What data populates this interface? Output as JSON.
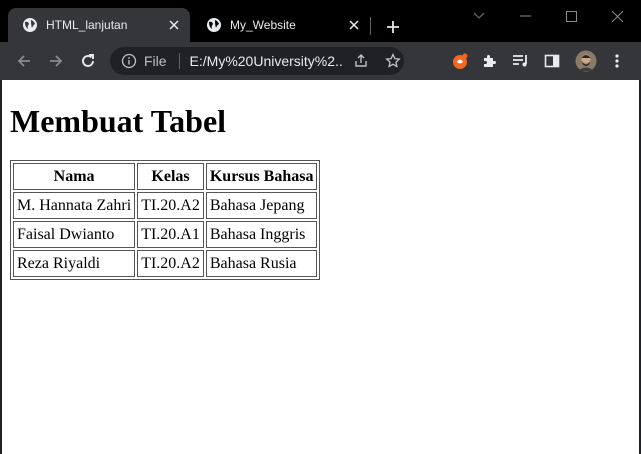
{
  "tabs": [
    {
      "title": "HTML_lanjutan",
      "active": true,
      "favicon": "globe-icon"
    },
    {
      "title": "My_Website",
      "active": false,
      "favicon": "globe-icon"
    }
  ],
  "toolbar": {
    "scheme": "File",
    "url": "E:/My%20University%2..."
  },
  "page": {
    "heading": "Membuat Tabel",
    "table": {
      "headers": [
        "Nama",
        "Kelas",
        "Kursus Bahasa"
      ],
      "rows": [
        [
          "M. Hannata Zahri",
          "TI.20.A2",
          "Bahasa Jepang"
        ],
        [
          "Faisal Dwianto",
          "TI.20.A1",
          "Bahasa Inggris"
        ],
        [
          "Reza Riyaldi",
          "TI.20.A2",
          "Bahasa Rusia"
        ]
      ]
    }
  },
  "colors": {
    "tabstrip": "#000000",
    "toolbar": "#35363a",
    "omnibox": "#202124",
    "extension_accent": "#f26722"
  }
}
